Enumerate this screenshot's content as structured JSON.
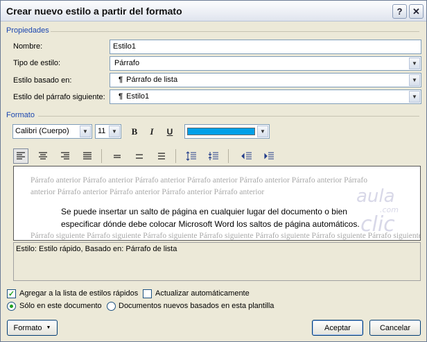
{
  "window": {
    "title": "Crear nuevo estilo a partir del formato",
    "help": "?",
    "close": "✕"
  },
  "propiedades": {
    "group_label": "Propiedades",
    "nombre_label": "Nombre:",
    "nombre_value": "Estilo1",
    "tipo_label": "Tipo de estilo:",
    "tipo_value": "Párrafo",
    "basado_label": "Estilo basado en:",
    "basado_value": "Párrafo de lista",
    "siguiente_label": "Estilo del párrafo siguiente:",
    "siguiente_value": "Estilo1",
    "pilcrow": "¶"
  },
  "formato": {
    "group_label": "Formato",
    "font": "Calibri (Cuerpo)",
    "size": "11",
    "bold": "B",
    "italic": "I",
    "underline": "U",
    "font_color": "#00a0e8"
  },
  "preview": {
    "before_line1": "Párrafo anterior Párrafo anterior Párrafo anterior Párrafo anterior Párrafo anterior Párrafo anterior Párrafo",
    "before_line2": "anterior Párrafo anterior Párrafo anterior Párrafo anterior Párrafo anterior",
    "main_line1": "Se puede insertar un salto de página en cualquier lugar del documento o bien",
    "main_line2": "especificar dónde debe colocar Microsoft Word los saltos de página automáticos.",
    "after_line": "Párrafo siguiente Párrafo siguiente Párrafo siguiente Párrafo siguiente Párrafo siguiente Párrafo siguiente Párrafo siguiente",
    "watermark_top": "aula",
    "watermark_mid": "clic",
    "watermark_small": ".com"
  },
  "description": "Estilo: Estilo rápido, Basado en: Párrafo de lista",
  "options": {
    "agregar_label": "Agregar a la lista de estilos rápidos",
    "agregar_checked": "✓",
    "actualizar_label": "Actualizar automáticamente",
    "solo_label": "Sólo en este documento",
    "nuevos_label": "Documentos nuevos basados en esta plantilla"
  },
  "buttons": {
    "formato": "Formato",
    "formato_arrow": "▼",
    "aceptar": "Aceptar",
    "cancelar": "Cancelar"
  },
  "dropdown_arrow": "▼"
}
